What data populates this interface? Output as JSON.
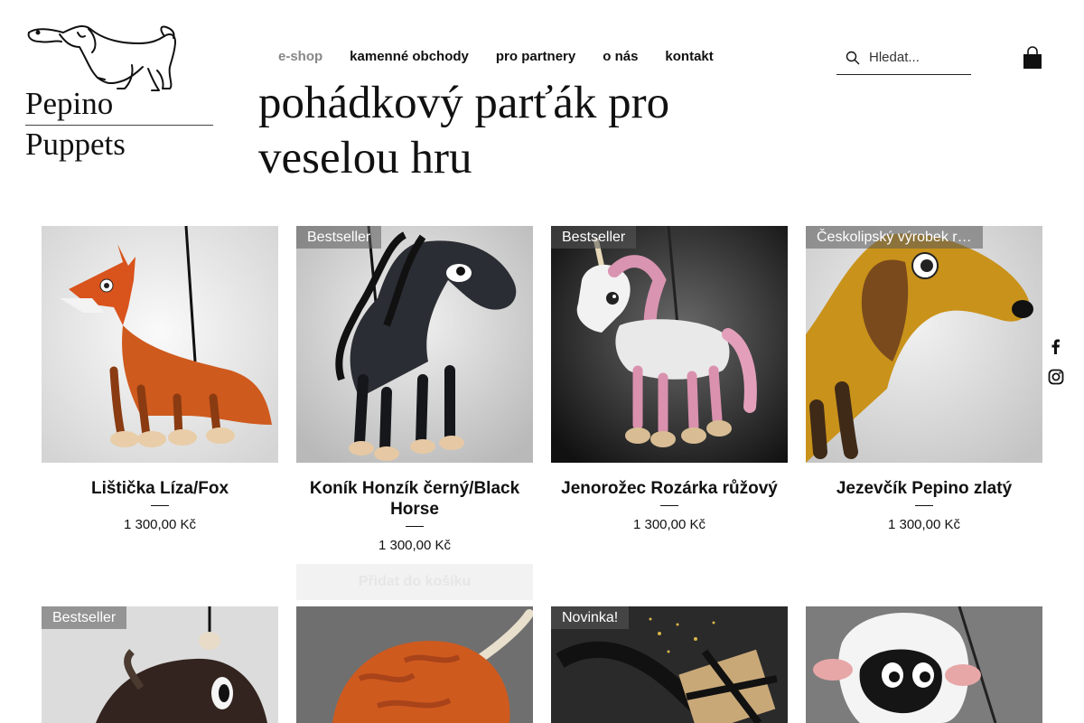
{
  "brand": {
    "line1": "Pepino",
    "line2": "Puppets"
  },
  "nav": [
    {
      "label": "e-shop",
      "active": true
    },
    {
      "label": "kamenné obchody"
    },
    {
      "label": "pro partnery"
    },
    {
      "label": "o nás"
    },
    {
      "label": "kontakt"
    }
  ],
  "search": {
    "placeholder": "Hledat..."
  },
  "headline": "pohádkový parťák pro veselou hru",
  "add_to_cart": "Přidat do košíku",
  "products": [
    {
      "title": "Lištička Líza/Fox",
      "price": "1 300,00 Kč",
      "badge": ""
    },
    {
      "title": "Koník Honzík černý/Black Horse",
      "price": "1 300,00 Kč",
      "badge": "Bestseller"
    },
    {
      "title": "Jenorožec Rozárka růžový",
      "price": "1 300,00 Kč",
      "badge": "Bestseller"
    },
    {
      "title": "Jezevčík Pepino zlatý",
      "price": "1 300,00 Kč",
      "badge": "Českolipský výrobek r…"
    },
    {
      "badge": "Bestseller"
    },
    {
      "badge": ""
    },
    {
      "badge": "Novinka!"
    },
    {
      "badge": ""
    }
  ],
  "icons": [
    "search-icon",
    "shopping-bag-icon",
    "facebook-icon",
    "instagram-icon"
  ]
}
